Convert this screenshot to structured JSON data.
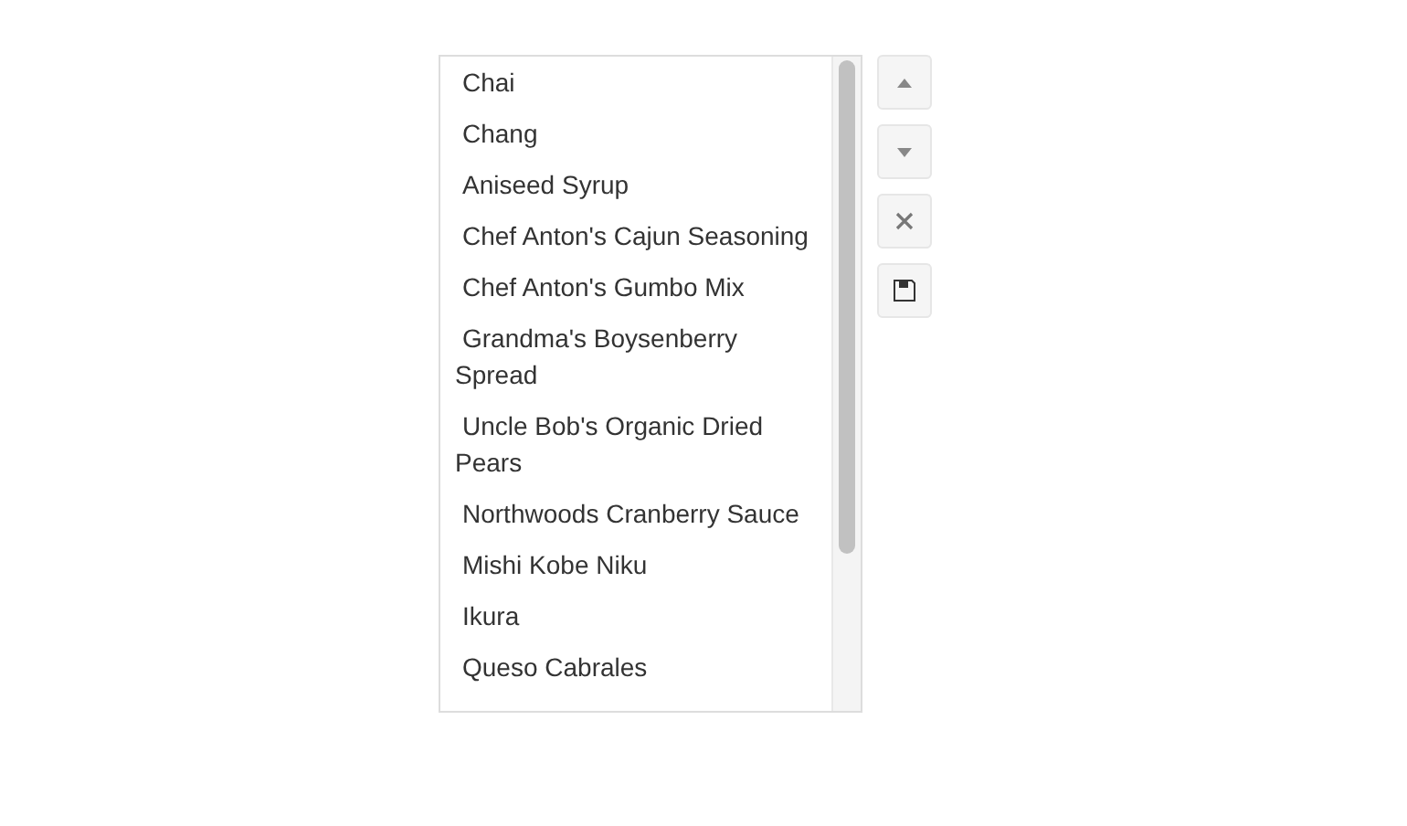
{
  "list": {
    "items": [
      {
        "label": "Chai"
      },
      {
        "label": "Chang"
      },
      {
        "label": "Aniseed Syrup"
      },
      {
        "label": "Chef Anton's Cajun Seasoning"
      },
      {
        "label": "Chef Anton's Gumbo Mix"
      },
      {
        "label": "Grandma's Boysenberry Spread"
      },
      {
        "label": "Uncle Bob's Organic Dried Pears"
      },
      {
        "label": "Northwoods Cranberry Sauce"
      },
      {
        "label": "Mishi Kobe Niku"
      },
      {
        "label": "Ikura"
      },
      {
        "label": "Queso Cabrales"
      }
    ]
  },
  "toolbar": [
    {
      "kind": "up"
    },
    {
      "kind": "down"
    },
    {
      "kind": "remove"
    },
    {
      "kind": "save"
    }
  ]
}
